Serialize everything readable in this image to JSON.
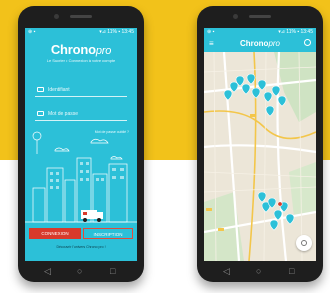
{
  "colors": {
    "brand_cyan": "#2cc0d8",
    "brand_red": "#d83a2b",
    "backdrop_yellow": "#f2c21a"
  },
  "left_phone": {
    "status": {
      "left": "⊕ ▪",
      "right": "▾⊿ 11% ▪ 13:45"
    },
    "logo": {
      "main": "Chrono",
      "suffix": "pro"
    },
    "tagline": "Le Sucrier • Connexion à votre compte",
    "fields": [
      {
        "icon": "user-icon",
        "placeholder": "Identifiant"
      },
      {
        "icon": "lock-icon",
        "placeholder": "Mot de passe"
      }
    ],
    "forgot": "Mot de passe oublié ?",
    "buttons": {
      "connexion": "CONNEXION",
      "inscription": "INSCRIPTION"
    },
    "bottom_text": "Découvrir l'univers Chrono pro !",
    "navbar": {
      "back": "◁",
      "home": "○",
      "recent": "□"
    }
  },
  "right_phone": {
    "status": {
      "left": "⊕ ▪",
      "right": "▾⊿ 11% ▪ 13:45"
    },
    "title": {
      "main": "Chrono",
      "suffix": "pro"
    },
    "menu_icon": "menu-icon",
    "search_icon": "search-icon",
    "pin_count": 18,
    "navbar": {
      "back": "◁",
      "home": "○",
      "recent": "□"
    }
  }
}
